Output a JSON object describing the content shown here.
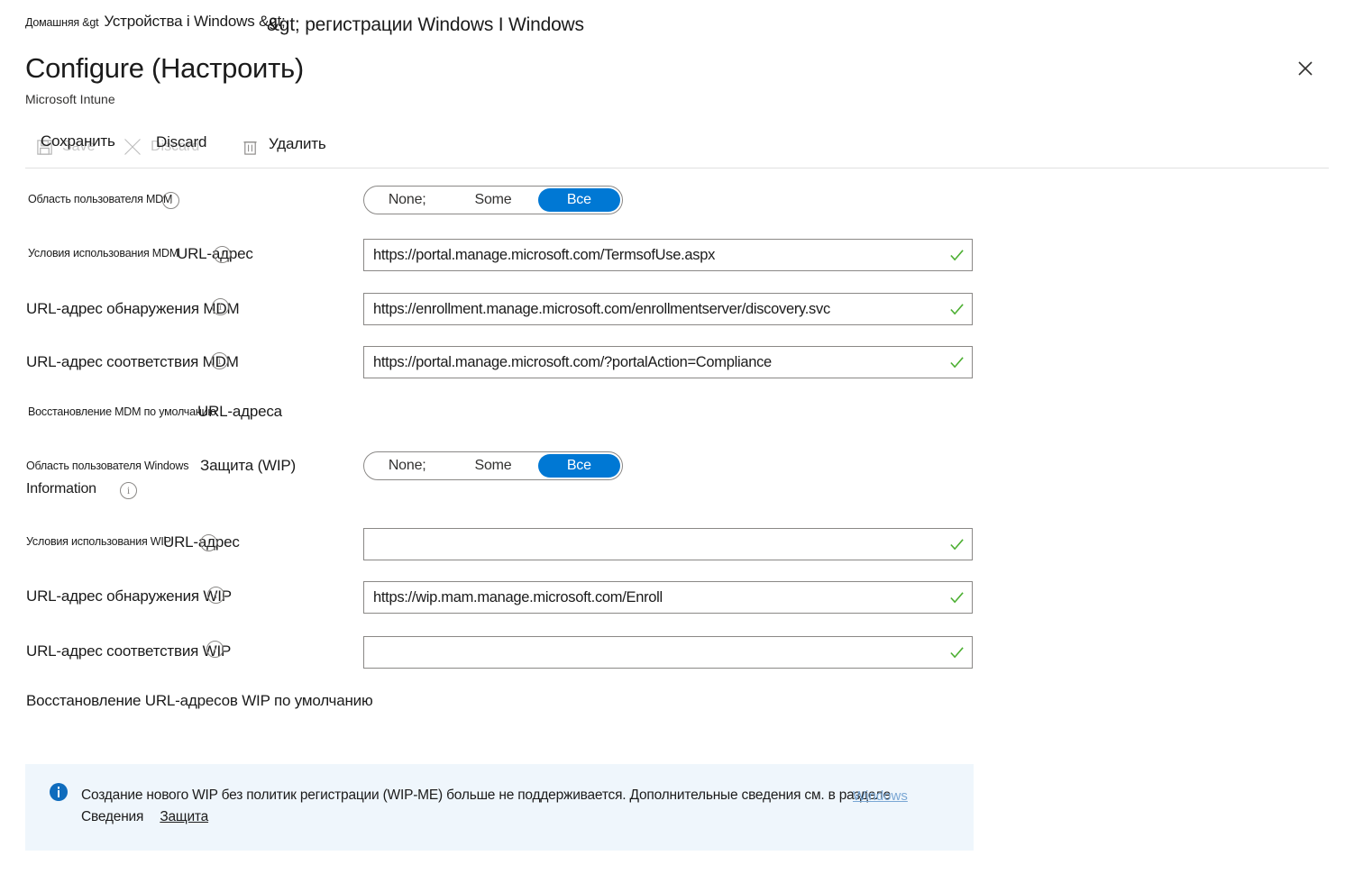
{
  "breadcrumb": {
    "part1": "Домашняя &gt",
    "part2": "Устройства i Windows &gt;",
    "part3": "&gt; регистрации Windows I Windows"
  },
  "header": {
    "title": "Configure (Настроить)",
    "subtitle": "Microsoft Intune",
    "close_icon": "close-icon"
  },
  "toolbar": {
    "save_ghost": "Save",
    "save_label": "Сохранить",
    "discard_ghost": "Discard",
    "discard_label": "Discard",
    "delete_label": "Удалить",
    "save_icon": "save-icon",
    "discard_icon": "close-x-icon",
    "delete_icon": "trash-icon"
  },
  "toggle_options": {
    "none": "None;",
    "some": "Some",
    "all": "Все"
  },
  "rows": {
    "mdm_user_scope": {
      "label_small": "Область пользователя MDM",
      "selected": "Все"
    },
    "mdm_terms_of_use": {
      "label_small": "Условия использования MDM",
      "label_big": "URL-адрес",
      "value": "https://portal.manage.microsoft.com/TermsofUse.aspx"
    },
    "mdm_discovery": {
      "label_big": "URL-адрес обнаружения MDM",
      "value": "https://enrollment.manage.microsoft.com/enrollmentserver/discovery.svc"
    },
    "mdm_compliance": {
      "label_big": "URL-адрес соответствия MDM",
      "value": "https://portal.manage.microsoft.com/?portalAction=Compliance"
    },
    "mdm_restore": {
      "label_small": "Восстановление MDM по умолчанию",
      "label_big": "URL-адреса"
    },
    "wip_user_scope": {
      "label_small": "Область пользователя Windows",
      "label_big": "Защита (WIP)",
      "label_line2": "Information",
      "selected": "Все"
    },
    "wip_terms_of_use": {
      "label_small": "Условия использования WIP",
      "label_big": "URL-адрес",
      "value": ""
    },
    "wip_discovery": {
      "label_big": "URL-адрес обнаружения WIP",
      "value": "https://wip.mam.manage.microsoft.com/Enroll"
    },
    "wip_compliance": {
      "label_big": "URL-адрес соответствия WIP",
      "value": ""
    },
    "wip_restore": {
      "label_big": "Восстановление URL-адресов WIP по умолчанию"
    }
  },
  "banner": {
    "icon": "info-filled-icon",
    "line1": "Создание нового WIP без политик регистрации (WIP-ME) больше не поддерживается. Дополнительные сведения см. в разделе",
    "ghost_link": "Windows",
    "line2_prefix": "Сведения",
    "line2_link": "Защита"
  },
  "colors": {
    "accent": "#0078d4",
    "check": "#4caf32",
    "banner_bg": "#eff6fc",
    "link": "#0f6cbd"
  }
}
